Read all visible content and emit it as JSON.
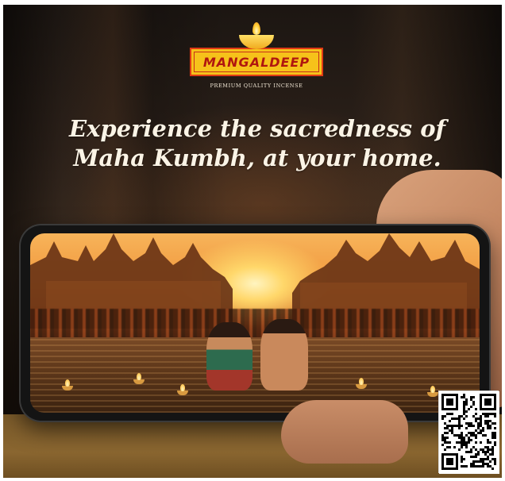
{
  "brand": {
    "name": "MANGALDEEP",
    "tagline": "PREMIUM QUALITY INCENSE",
    "colors": {
      "badge_yellow": "#f6c21a",
      "badge_red": "#e03a14",
      "text_red": "#b0160f"
    }
  },
  "headline": {
    "line1": "Experience the sacredness of",
    "line2": "Maha Kumbh, at your home."
  },
  "icons": {
    "diya": "diya-lamp-icon",
    "qr": "qr-code-icon"
  }
}
